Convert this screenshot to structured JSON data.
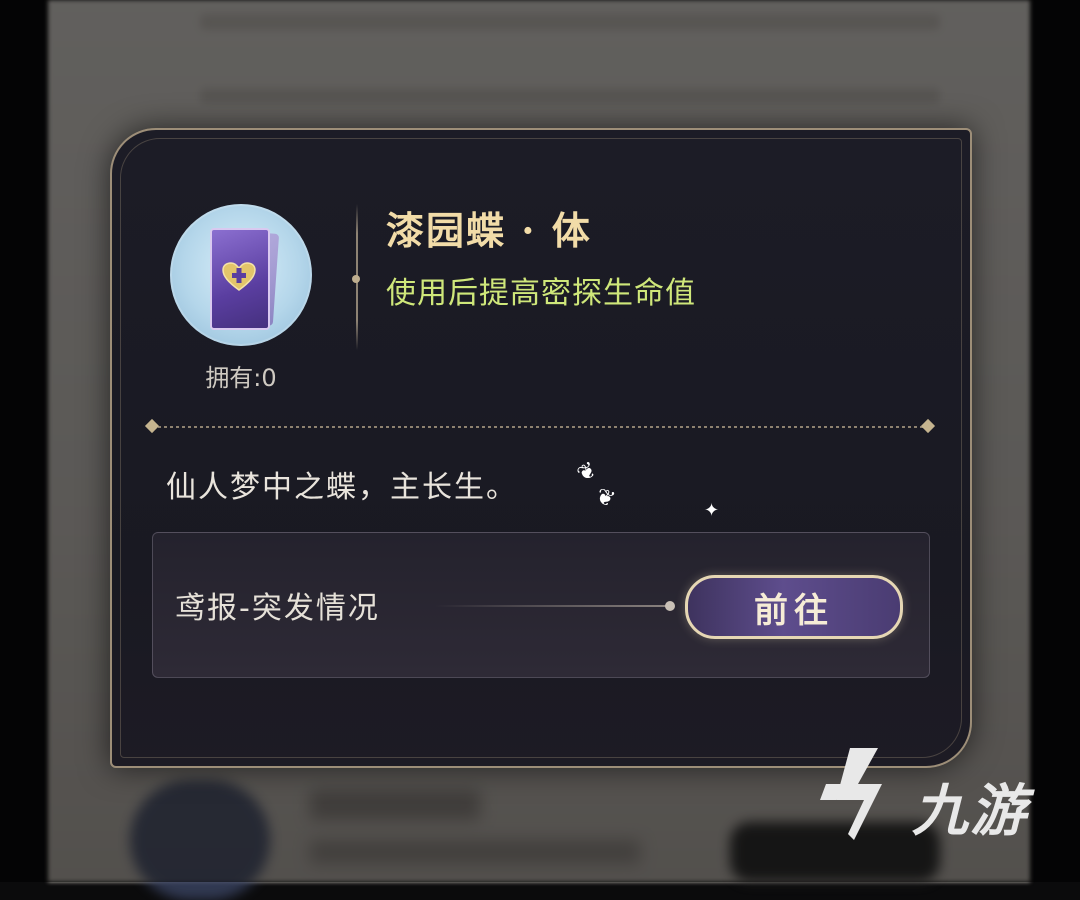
{
  "item": {
    "name": "漆园蝶 · 体",
    "effect": "使用后提高密探生命值",
    "owned_label": "拥有:0",
    "icon": "heart-card-icon",
    "description": "仙人梦中之蝶，主长生。"
  },
  "source": {
    "label": "鸢报-突发情况",
    "button_label": "前往"
  },
  "watermark": {
    "text": "九游",
    "icon": "jiuyou-logo-icon"
  },
  "colors": {
    "title": "#f2dca8",
    "effect": "#cfe77a",
    "border": "#9d8e78",
    "button": "#5e4d8d"
  }
}
